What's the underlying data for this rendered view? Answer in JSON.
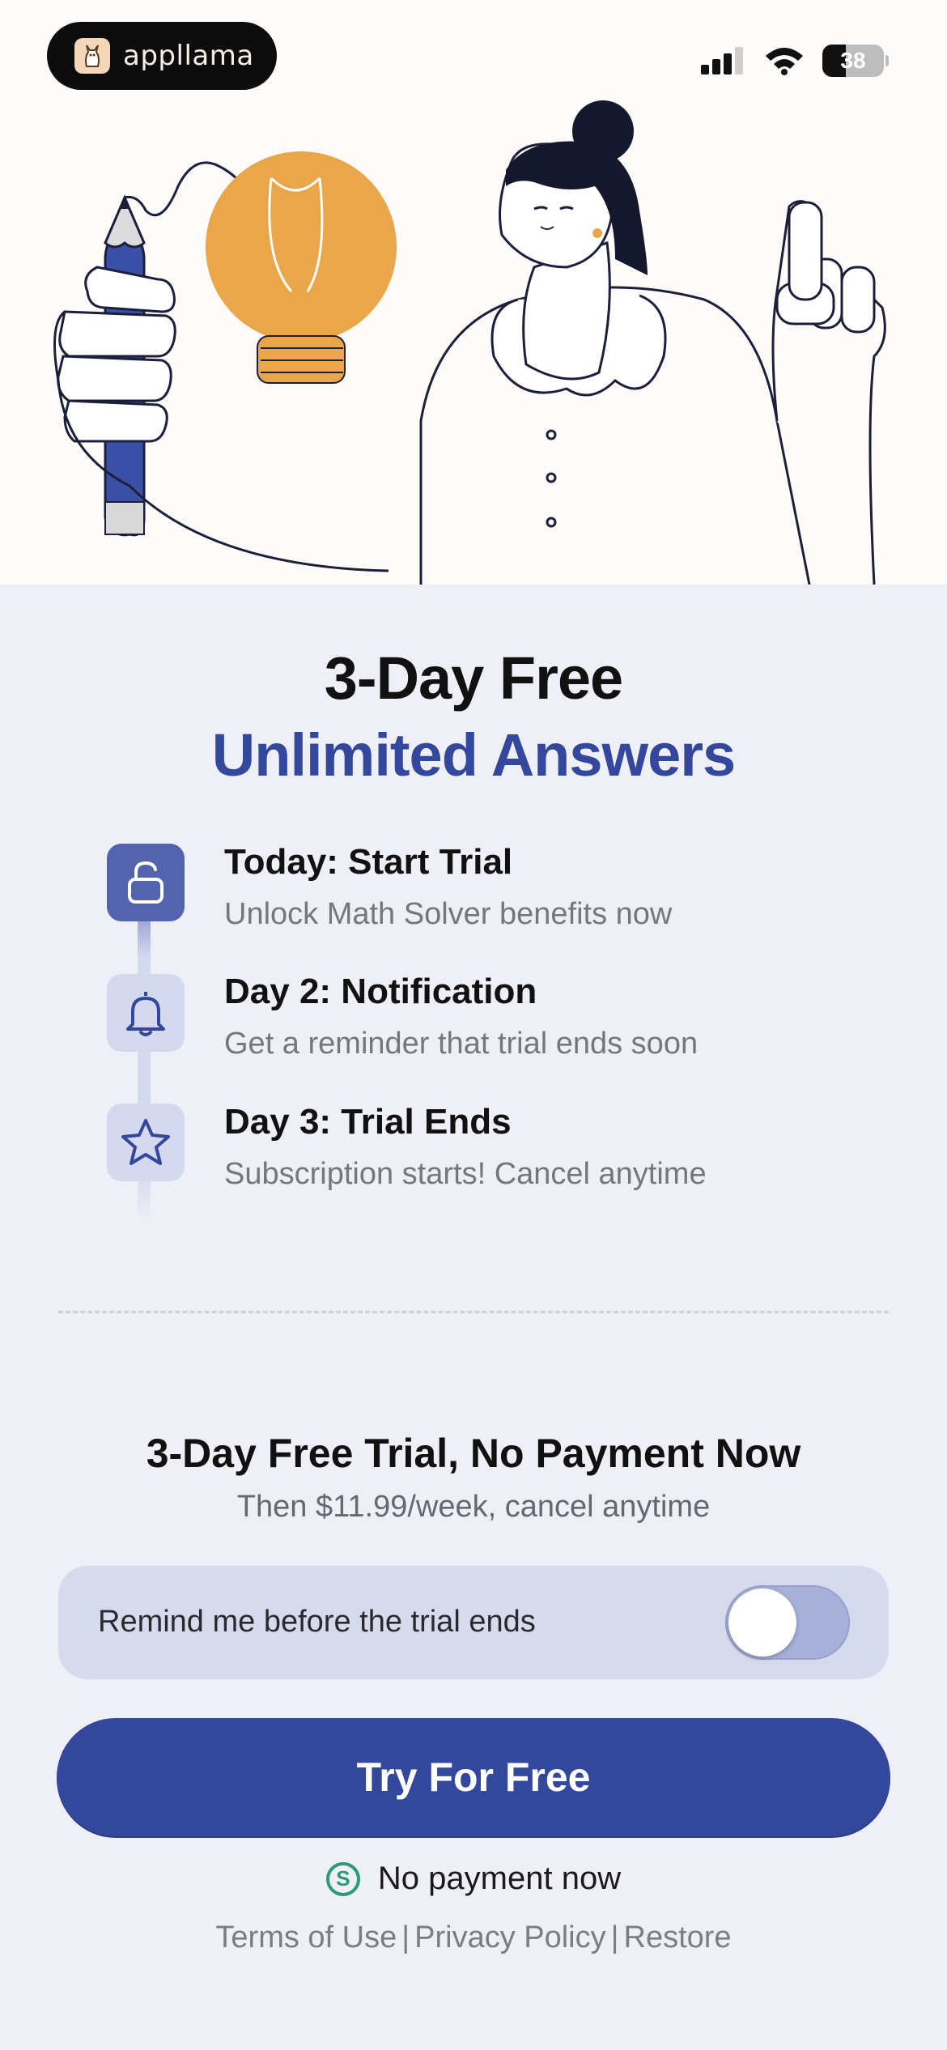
{
  "brand": {
    "name": "appllama",
    "logo_icon": "llama-logo-icon"
  },
  "status_bar": {
    "battery": "38",
    "battery_level": 0.38,
    "signal_icon": "cellular-signal-icon",
    "wifi_icon": "wifi-icon"
  },
  "hero": {
    "illustration": "person-with-lightbulb-and-pencil"
  },
  "headline": {
    "line1": "3-Day Free",
    "line2": "Unlimited Answers",
    "accent_color": "#33479c"
  },
  "timeline": [
    {
      "icon": "unlock-icon",
      "title": "Today: Start Trial",
      "subtitle": "Unlock Math Solver benefits now",
      "active": true
    },
    {
      "icon": "bell-icon",
      "title": "Day 2: Notification",
      "subtitle": "Get a reminder that trial ends soon",
      "active": false
    },
    {
      "icon": "star-icon",
      "title": "Day 3: Trial Ends",
      "subtitle": "Subscription starts! Cancel anytime",
      "active": false
    }
  ],
  "offer": {
    "title": "3-Day Free Trial, No Payment Now",
    "subtitle": "Then $11.99/week, cancel anytime"
  },
  "reminder": {
    "label": "Remind me before the trial ends",
    "enabled": false
  },
  "cta": {
    "label": "Try For Free"
  },
  "no_payment": {
    "icon": "dollar-circle-icon",
    "text": "No payment now"
  },
  "footer_links": {
    "terms": "Terms of Use",
    "privacy": "Privacy Policy",
    "restore": "Restore",
    "separator": "|"
  }
}
